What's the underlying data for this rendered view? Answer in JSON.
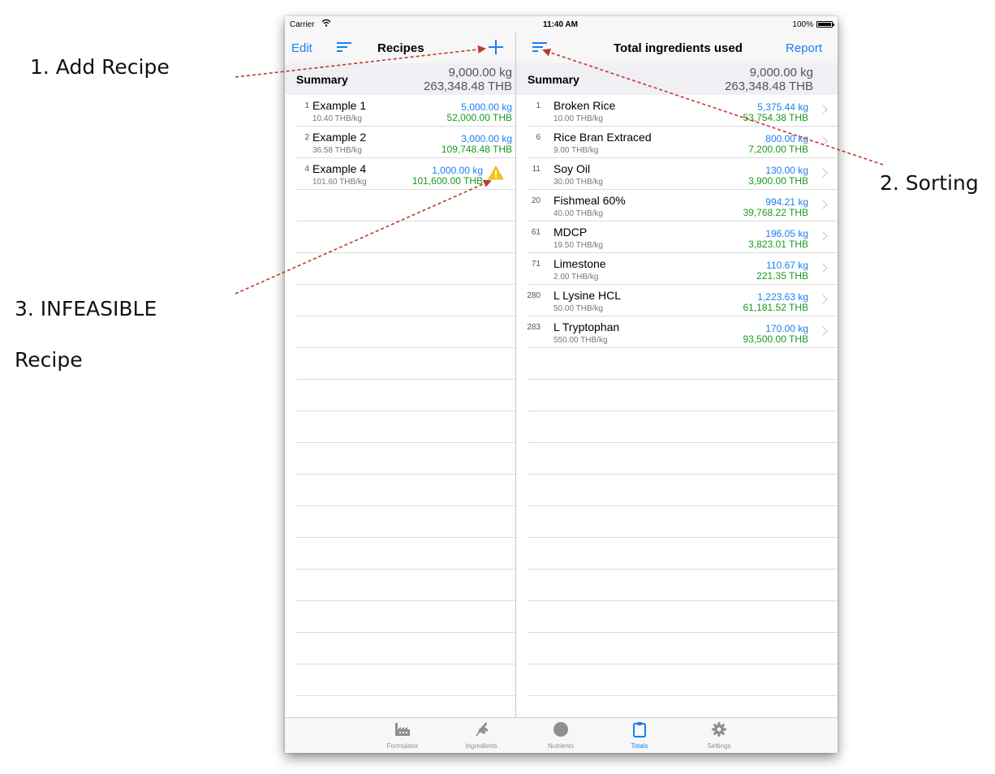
{
  "annotations": {
    "add_recipe": "1. Add Recipe",
    "sorting": "2. Sorting",
    "infeasible_line1": "3. INFEASIBLE",
    "infeasible_line2": "Recipe"
  },
  "status_bar": {
    "carrier": "Carrier",
    "time": "11:40 AM",
    "battery": "100%"
  },
  "left_pane": {
    "edit_label": "Edit",
    "title": "Recipes",
    "summary": {
      "label": "Summary",
      "kg": "9,000.00 kg",
      "thb": "263,348.48 THB"
    },
    "recipes": [
      {
        "index": "1",
        "name": "Example 1",
        "price": "10.40 THB/kg",
        "kg": "5,000.00 kg",
        "thb": "52,000.00 THB",
        "warning": false
      },
      {
        "index": "2",
        "name": "Example 2",
        "price": "36.58 THB/kg",
        "kg": "3,000.00 kg",
        "thb": "109,748.48 THB",
        "warning": false
      },
      {
        "index": "4",
        "name": "Example 4",
        "price": "101.60 THB/kg",
        "kg": "1,000.00 kg",
        "thb": "101,600.00 THB",
        "warning": true
      }
    ]
  },
  "right_pane": {
    "title": "Total ingredients used",
    "report_label": "Report",
    "summary": {
      "label": "Summary",
      "kg": "9,000.00 kg",
      "thb": "263,348.48 THB"
    },
    "ingredients": [
      {
        "index": "1",
        "name": "Broken Rice",
        "price": "10.00 THB/kg",
        "kg": "5,375.44 kg",
        "thb": "53,754.38 THB"
      },
      {
        "index": "6",
        "name": "Rice Bran Extraced",
        "price": "9.00 THB/kg",
        "kg": "800.00 kg",
        "thb": "7,200.00 THB"
      },
      {
        "index": "11",
        "name": "Soy Oil",
        "price": "30.00 THB/kg",
        "kg": "130.00 kg",
        "thb": "3,900.00 THB"
      },
      {
        "index": "20",
        "name": "Fishmeal 60%",
        "price": "40.00 THB/kg",
        "kg": "994.21 kg",
        "thb": "39,768.22 THB"
      },
      {
        "index": "61",
        "name": "MDCP",
        "price": "19.50 THB/kg",
        "kg": "196.05 kg",
        "thb": "3,823.01 THB"
      },
      {
        "index": "71",
        "name": "Limestone",
        "price": "2.00 THB/kg",
        "kg": "110.67 kg",
        "thb": "221.35 THB"
      },
      {
        "index": "280",
        "name": "L Lysine HCL",
        "price": "50.00 THB/kg",
        "kg": "1,223.63 kg",
        "thb": "61,181.52 THB"
      },
      {
        "index": "283",
        "name": "L Tryptophan",
        "price": "550.00 THB/kg",
        "kg": "170.00 kg",
        "thb": "93,500.00 THB"
      }
    ]
  },
  "tab_bar": {
    "tabs": [
      {
        "label": "Formulator",
        "icon": "factory-icon",
        "active": false
      },
      {
        "label": "Ingredients",
        "icon": "wheat-icon",
        "active": false
      },
      {
        "label": "Nutrients",
        "icon": "circle-icon",
        "active": false
      },
      {
        "label": "Totals",
        "icon": "clipboard-icon",
        "active": true
      },
      {
        "label": "Settings",
        "icon": "gear-icon",
        "active": false
      }
    ]
  },
  "colors": {
    "accent_blue": "#1a7ff2",
    "quantity_green": "#1a9a1a",
    "arrow_red": "#c0392b",
    "warning_yellow": "#f5c518"
  }
}
